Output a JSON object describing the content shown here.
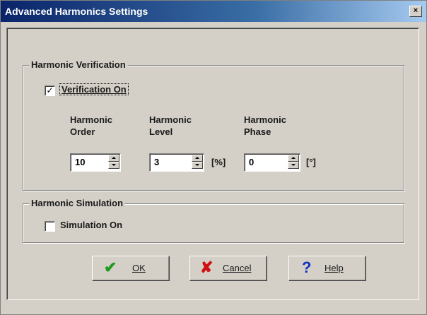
{
  "window": {
    "title": "Advanced Harmonics Settings",
    "close_glyph": "×"
  },
  "verification": {
    "group_title": "Harmonic Verification",
    "checkbox_label": "Verification On",
    "checked_glyph": "✓",
    "checked": true,
    "order": {
      "label_line1": "Harmonic",
      "label_line2": "Order",
      "value": "10"
    },
    "level": {
      "label_line1": "Harmonic",
      "label_line2": "Level",
      "value": "3",
      "unit": "[%]"
    },
    "phase": {
      "label_line1": "Harmonic",
      "label_line2": "Phase",
      "value": "0",
      "unit": "[°]"
    }
  },
  "simulation": {
    "group_title": "Harmonic Simulation",
    "checkbox_label": "Simulation On",
    "checked": false
  },
  "buttons": {
    "ok": {
      "label": "OK",
      "icon": "✔",
      "icon_name": "checkmark-icon",
      "color": "#1e9a1e"
    },
    "cancel": {
      "label": "Cancel",
      "icon": "✘",
      "icon_name": "cross-icon",
      "color": "#d01010"
    },
    "help": {
      "label": "Help",
      "icon": "?",
      "icon_name": "question-icon",
      "color": "#1030c0"
    }
  }
}
